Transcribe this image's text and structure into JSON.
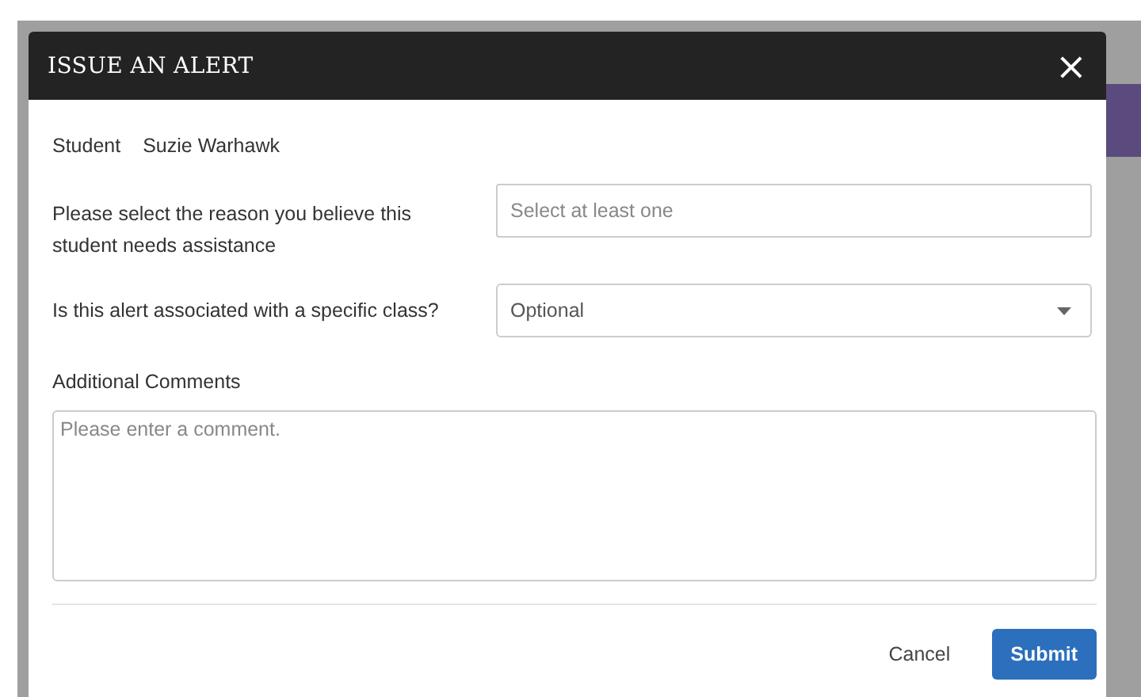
{
  "dialog": {
    "title": "ISSUE AN ALERT",
    "close": "×"
  },
  "student": {
    "label": "Student",
    "value": "Suzie Warhawk"
  },
  "reason": {
    "label": "Please select the reason you believe this student needs assistance",
    "placeholder": "Select at least one"
  },
  "class": {
    "label": "Is this alert associated with a specific class?",
    "value": "Optional"
  },
  "comments": {
    "label": "Additional Comments",
    "placeholder": "Please enter a comment."
  },
  "buttons": [
    {
      "label": "Cancel",
      "kind": "link"
    },
    {
      "label": "Submit",
      "kind": "primary"
    }
  ]
}
